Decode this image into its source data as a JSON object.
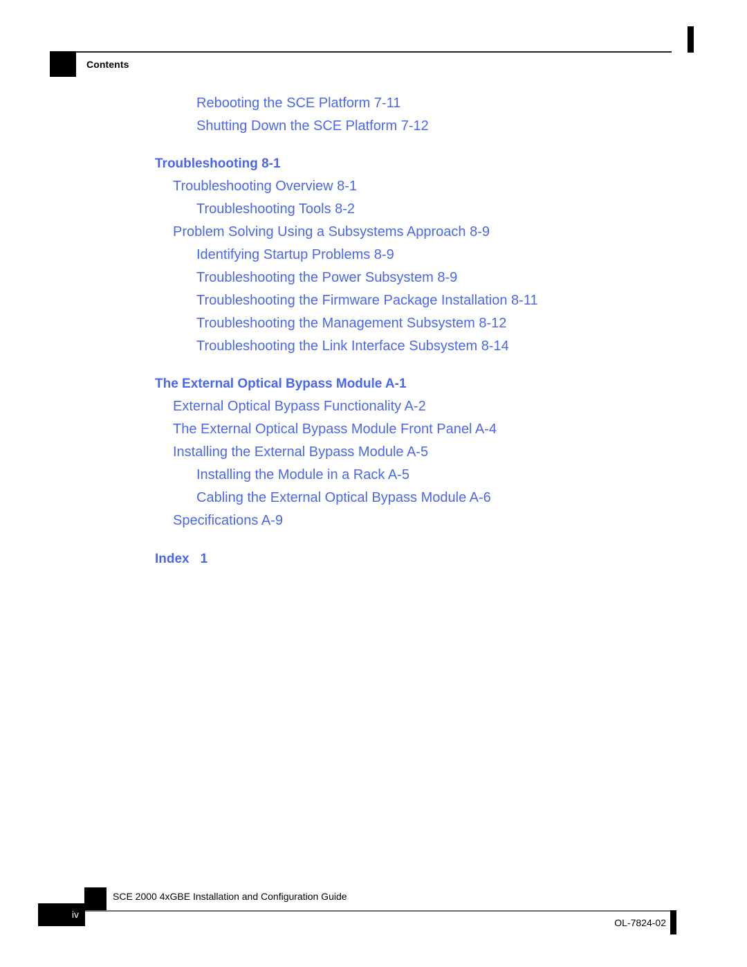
{
  "header": {
    "chapter_label": "Contents"
  },
  "toc": {
    "entries": [
      {
        "text": "Rebooting the SCE Platform 7-11",
        "level": 2,
        "gap": false
      },
      {
        "text": "Shutting Down the SCE Platform 7-12",
        "level": 2,
        "gap": false
      },
      {
        "text": "Troubleshooting 8-1",
        "level": 0,
        "gap": true
      },
      {
        "text": "Troubleshooting Overview 8-1",
        "level": 1,
        "gap": false
      },
      {
        "text": "Troubleshooting Tools 8-2",
        "level": 2,
        "gap": false
      },
      {
        "text": "Problem Solving Using a Subsystems Approach 8-9",
        "level": 1,
        "gap": false
      },
      {
        "text": "Identifying Startup Problems 8-9",
        "level": 2,
        "gap": false
      },
      {
        "text": "Troubleshooting the Power Subsystem 8-9",
        "level": 2,
        "gap": false
      },
      {
        "text": "Troubleshooting the Firmware Package Installation 8-11",
        "level": 2,
        "gap": false
      },
      {
        "text": "Troubleshooting the Management Subsystem 8-12",
        "level": 2,
        "gap": false
      },
      {
        "text": "Troubleshooting the Link Interface Subsystem 8-14",
        "level": 2,
        "gap": false
      },
      {
        "text": "The External Optical Bypass Module A-1",
        "level": 0,
        "gap": true
      },
      {
        "text": "External Optical Bypass Functionality A-2",
        "level": 1,
        "gap": false
      },
      {
        "text": "The External Optical Bypass Module Front Panel A-4",
        "level": 1,
        "gap": false
      },
      {
        "text": "Installing the External Bypass Module A-5",
        "level": 1,
        "gap": false
      },
      {
        "text": "Installing the Module in a Rack A-5",
        "level": 2,
        "gap": false
      },
      {
        "text": "Cabling the External Optical Bypass Module A-6",
        "level": 2,
        "gap": false
      },
      {
        "text": "Specifications A-9",
        "level": 1,
        "gap": false
      },
      {
        "text": "Index\t1",
        "level": 0,
        "gap": true
      }
    ]
  },
  "footer": {
    "document_title": "SCE 2000 4xGBE Installation and Configuration Guide",
    "page_number": "iv",
    "document_id": "OL-7824-02"
  },
  "colors": {
    "link_blue": "#4a66ee",
    "rule_black": "#231f20",
    "rule_gray": "#6d6e71",
    "black": "#000000"
  }
}
